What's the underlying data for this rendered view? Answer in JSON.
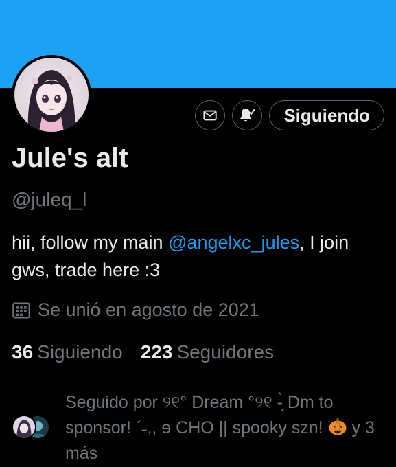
{
  "banner": {
    "color": "#1da1f2"
  },
  "avatar": {
    "description_icon": "profile-photo"
  },
  "actions": {
    "message_icon": "envelope-icon",
    "notify_icon": "bell-check-icon",
    "follow_label": "Siguiendo"
  },
  "profile": {
    "display_name": "Jule's alt",
    "handle": "@juleq_l",
    "bio_prefix": "hii, follow my main ",
    "bio_mention": "@angelxc_jules",
    "bio_suffix": ", I join gws, trade here :3",
    "joined_text": "Se unió en agosto de 2021"
  },
  "stats": {
    "following_count": "36",
    "following_label": "Siguiendo",
    "followers_count": "223",
    "followers_label": "Seguidores"
  },
  "followed_by": {
    "text_part1": "Seguido por ୨୧° Dream °୨୧ -̗̀ Dm to sponsor! ˊ˗,, ɘ CHO || spooky szn! ",
    "text_part2": " y 3 más"
  },
  "colors": {
    "accent": "#1d9bf0",
    "secondary_text": "#71767b",
    "primary_text": "#e7e9ea"
  }
}
